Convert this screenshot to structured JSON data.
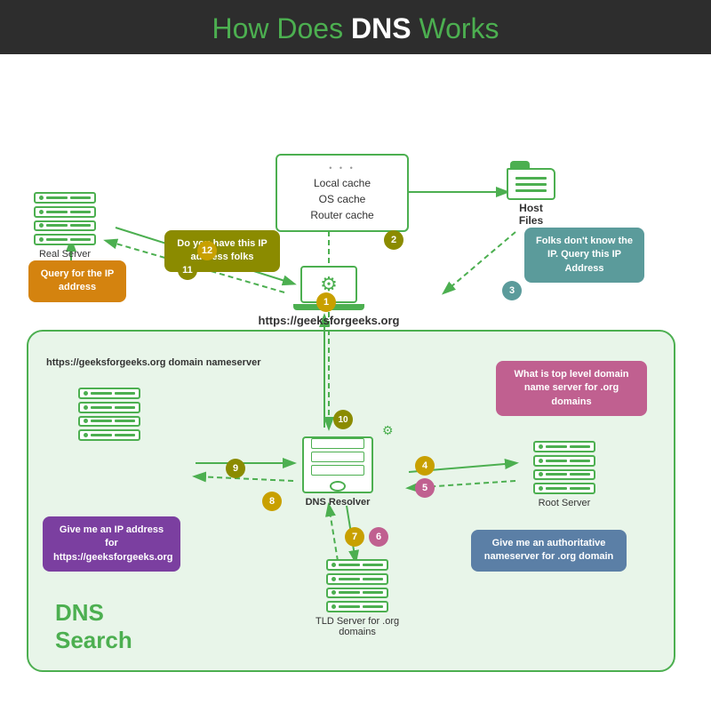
{
  "header": {
    "title_normal": "How Does ",
    "title_bold": "DNS",
    "title_suffix": " Works"
  },
  "cache_box": {
    "dots": "...",
    "lines": [
      "Local cache",
      "OS cache",
      "Router cache"
    ]
  },
  "host_files": {
    "label": "Host\nFiles"
  },
  "laptop_url": "https://geeksforgeeks.org",
  "bubbles": {
    "do_you_have": "Do you have this\nIP address folks",
    "folks_dont_know": "Folks don't know\nthe IP. Query this\nIP Address",
    "give_me_ip": "Give me an\nIP address for\nhttps://geeksforgeeks.org",
    "give_me_auth": "Give me an\nauthoritative nameserver\nfor .org domain",
    "what_is_top": "What is top level\ndomain name server\nfor .org domains",
    "query_ip": "Query for the IP\naddress"
  },
  "labels": {
    "real_server": "Real Server",
    "dns_resolver": "DNS Resolver",
    "root_server": "Root Server",
    "tld_server": "TLD Server for .org\ndomains",
    "dns_nameserver": "https://geeksforgeeks.org\ndomain nameserver",
    "dns_search": "DNS\nSearch"
  },
  "numbers": [
    "1",
    "2",
    "3",
    "4",
    "5",
    "6",
    "7",
    "8",
    "9",
    "10",
    "11",
    "12"
  ]
}
